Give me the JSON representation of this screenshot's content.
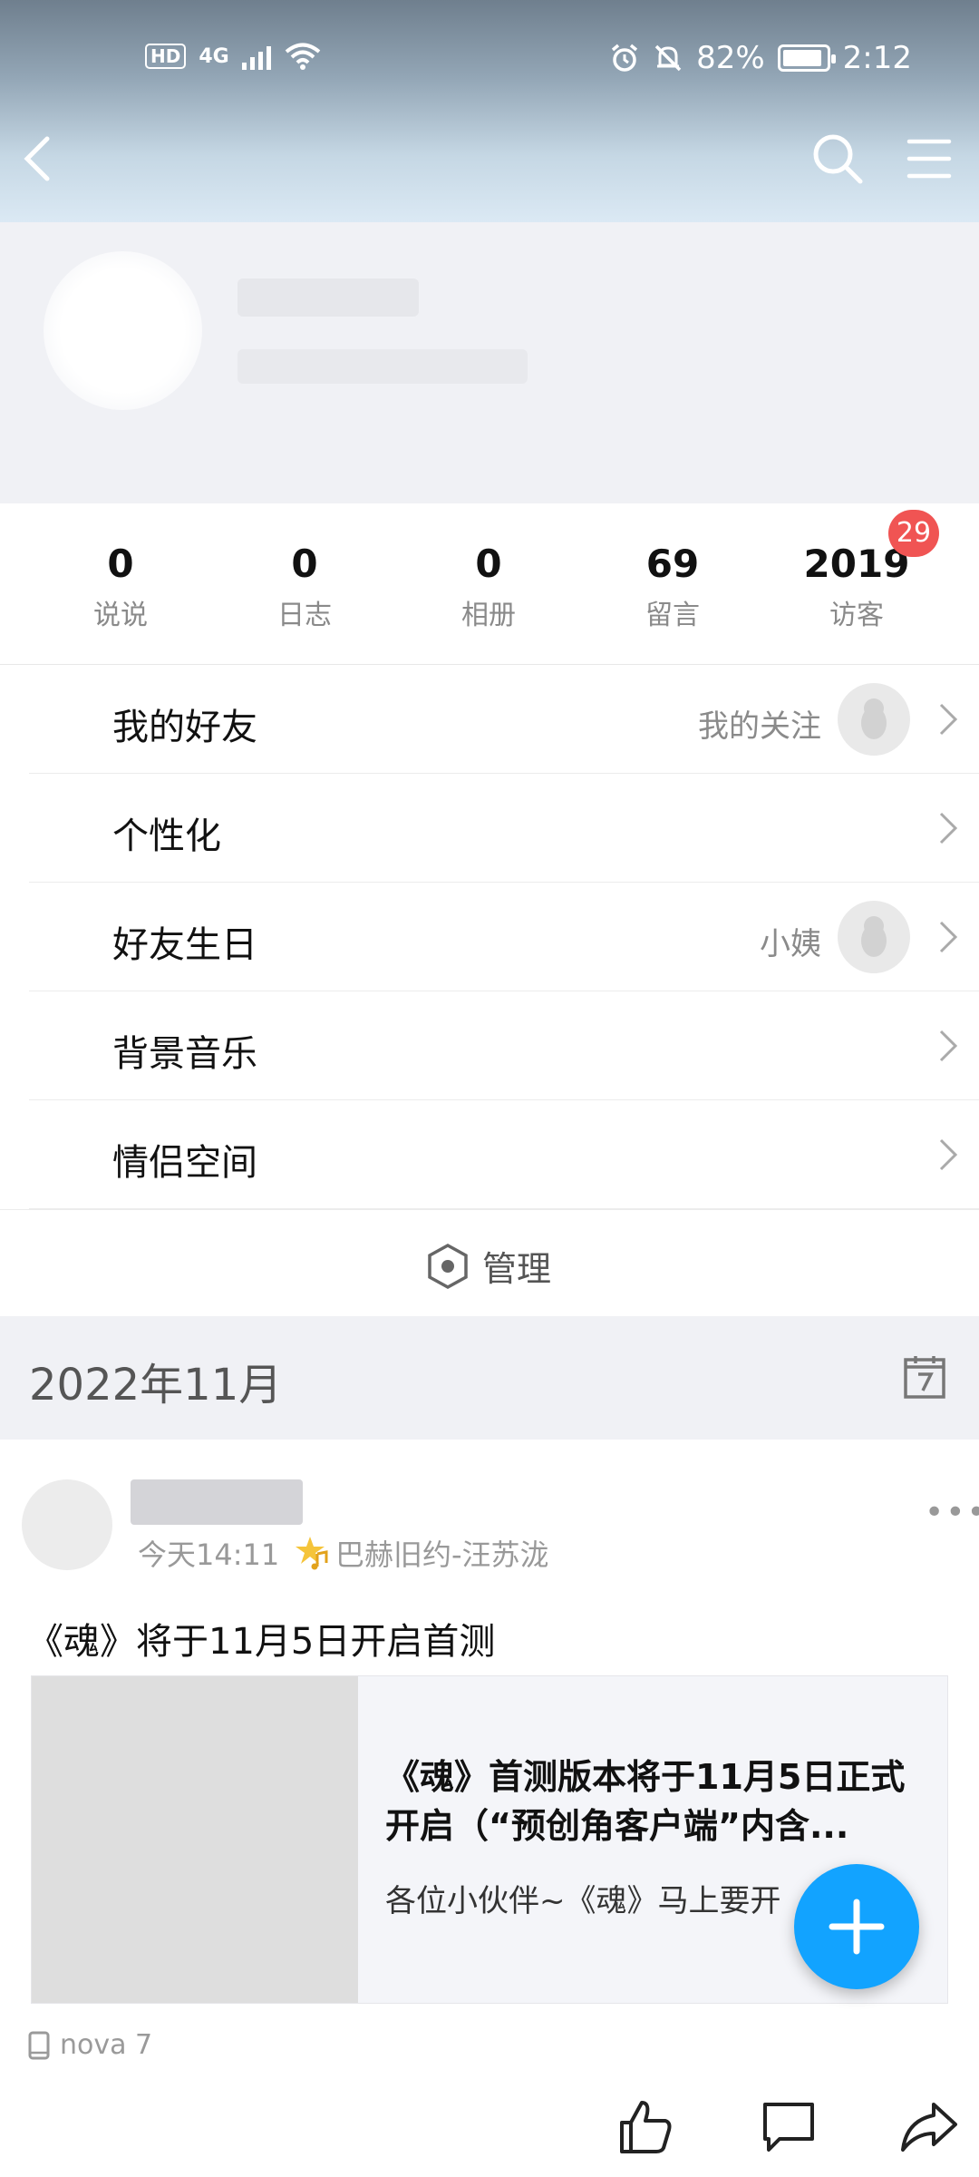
{
  "status_bar": {
    "left_badge": "HD",
    "network": "4G",
    "battery_percent": "82%",
    "time": "2:12"
  },
  "nav": {
    "back_icon": "chevron-left-icon",
    "search_icon": "search-icon",
    "menu_icon": "hamburger-menu-icon"
  },
  "stats": [
    {
      "value": "0",
      "label": "说说"
    },
    {
      "value": "0",
      "label": "日志"
    },
    {
      "value": "0",
      "label": "相册"
    },
    {
      "value": "69",
      "label": "留言"
    },
    {
      "value": "2019",
      "label": "访客"
    }
  ],
  "visitor_badge": "29",
  "menu_items": [
    {
      "title": "我的好友",
      "right": "我的关注",
      "avatar": true
    },
    {
      "title": "个性化",
      "right": "",
      "avatar": false
    },
    {
      "title": "好友生日",
      "right": "小姨",
      "avatar": true
    },
    {
      "title": "背景音乐",
      "right": "",
      "avatar": false
    },
    {
      "title": "情侣空间",
      "right": "",
      "avatar": false
    }
  ],
  "manage_label": "管理",
  "month_label": "2022年11月",
  "post": {
    "time": "今天14:11",
    "song": "巴赫旧约-汪苏泷",
    "text": "《魂》将于11月5日开启首测",
    "card_title": "《魂》首测版本将于11月5日正式开启（“预创角客户端”内含...",
    "card_sub": "各位小伙伴~《魂》马上要开",
    "device": "nova 7"
  }
}
